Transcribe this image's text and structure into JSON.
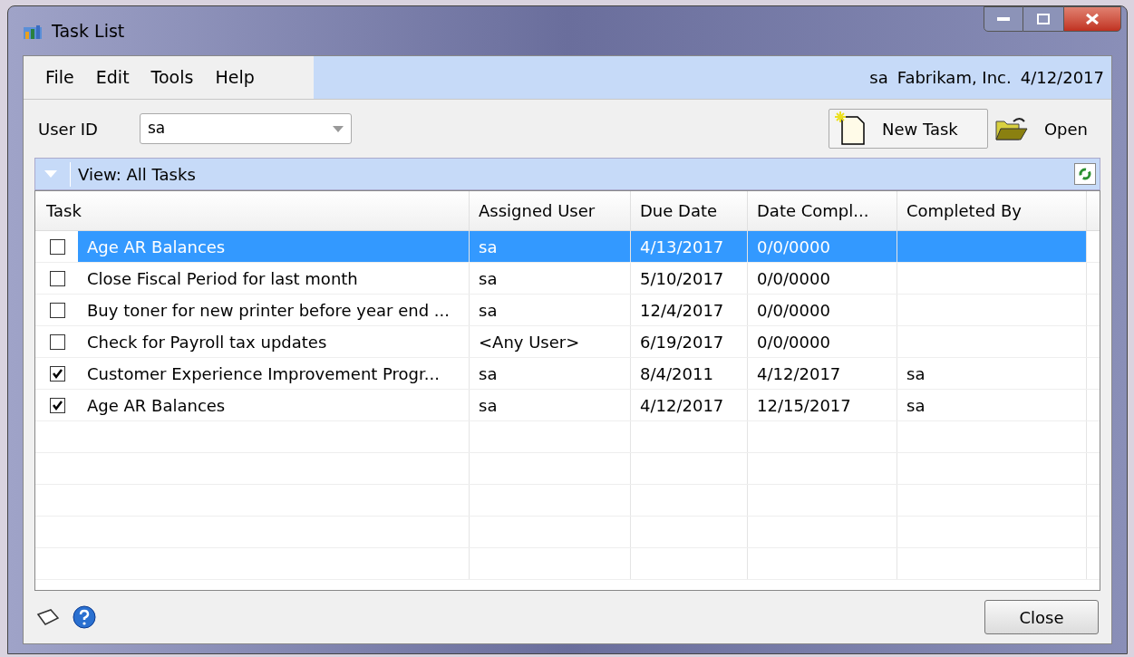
{
  "window": {
    "title": "Task List"
  },
  "menu": [
    "File",
    "Edit",
    "Tools",
    "Help"
  ],
  "status": {
    "user": "sa",
    "company": "Fabrikam, Inc.",
    "date": "4/12/2017"
  },
  "user_id": {
    "label": "User ID",
    "value": "sa"
  },
  "toolbar": {
    "new_task": "New Task",
    "open": "Open"
  },
  "view": {
    "label": "View: All Tasks"
  },
  "table": {
    "columns": [
      "Task",
      "Assigned User",
      "Due Date",
      "Date Compl...",
      "Completed By"
    ],
    "rows": [
      {
        "checked": false,
        "selected": true,
        "cells": [
          "Age AR Balances",
          "sa",
          "4/13/2017",
          "0/0/0000",
          ""
        ]
      },
      {
        "checked": false,
        "selected": false,
        "cells": [
          "Close Fiscal Period for last month",
          "sa",
          "5/10/2017",
          "0/0/0000",
          ""
        ]
      },
      {
        "checked": false,
        "selected": false,
        "cells": [
          "Buy toner for new printer before year end ...",
          "sa",
          "12/4/2017",
          "0/0/0000",
          ""
        ]
      },
      {
        "checked": false,
        "selected": false,
        "cells": [
          "Check for Payroll tax updates",
          "<Any User>",
          "6/19/2017",
          "0/0/0000",
          ""
        ]
      },
      {
        "checked": true,
        "selected": false,
        "cells": [
          "Customer Experience Improvement Progr...",
          "sa",
          "8/4/2011",
          "4/12/2017",
          "sa"
        ]
      },
      {
        "checked": true,
        "selected": false,
        "cells": [
          "Age AR Balances",
          "sa",
          "4/12/2017",
          "12/15/2017",
          "sa"
        ]
      }
    ]
  },
  "buttons": {
    "close": "Close"
  }
}
